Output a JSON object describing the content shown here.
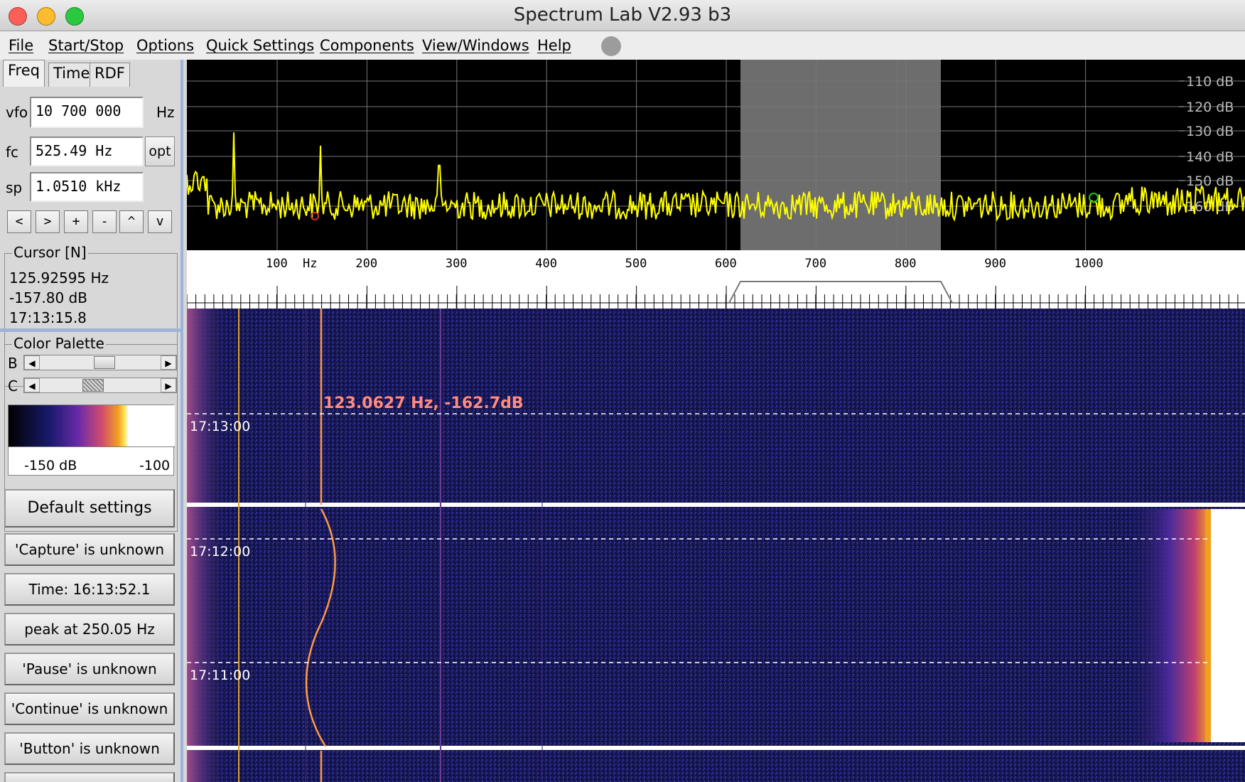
{
  "window": {
    "title": "Spectrum Lab V2.93 b3"
  },
  "menu": [
    "File",
    "Start/Stop",
    "Options",
    "Quick Settings",
    "Components",
    "View/Windows",
    "Help"
  ],
  "tabs": [
    "Freq",
    "Time",
    "RDF"
  ],
  "freq_panel": {
    "vfo_label": "vfo",
    "vfo_value": "10 700 000",
    "vfo_unit": "Hz",
    "fc_label": "fc",
    "fc_value": "525.49 Hz",
    "opt_label": "opt",
    "sp_label": "sp",
    "sp_value": "1.0510 kHz",
    "step_buttons": [
      "<",
      ">",
      "+",
      "-",
      "^",
      "v"
    ]
  },
  "cursor": {
    "title": "Cursor [N]",
    "freq": "125.92595 Hz",
    "level": "-157.80 dB",
    "time": "17:13:15.8"
  },
  "palette": {
    "title": "Color Palette",
    "b_label": "B",
    "c_label": "C",
    "min_label": "-150 dB",
    "max_label": "-100"
  },
  "buttons": [
    "Default settings",
    "'Capture' is unknown",
    "Time:  16:13:52.1",
    "peak at 250.05 Hz",
    "'Pause' is unknown",
    "'Continue' is unknown",
    "'Button' is unknown"
  ],
  "spectrum": {
    "db_labels": [
      "110 dB",
      "120 dB",
      "130 dB",
      "140 dB",
      "150 dB",
      "160 dB"
    ],
    "freq_ticks": [
      "100",
      "200",
      "300",
      "400",
      "500",
      "600",
      "700",
      "800",
      "900",
      "1000"
    ],
    "freq_unit": "Hz"
  },
  "waterfall": {
    "marker_readout": "123.0627 Hz, -162.7dB",
    "time_labels": [
      "17:13:00",
      "17:12:00",
      "17:11:00"
    ]
  },
  "colors": {
    "trace": "#ffff00",
    "marker": "#ff9a40",
    "readout": "#ff8a80",
    "accent": "#9fb3d9"
  }
}
